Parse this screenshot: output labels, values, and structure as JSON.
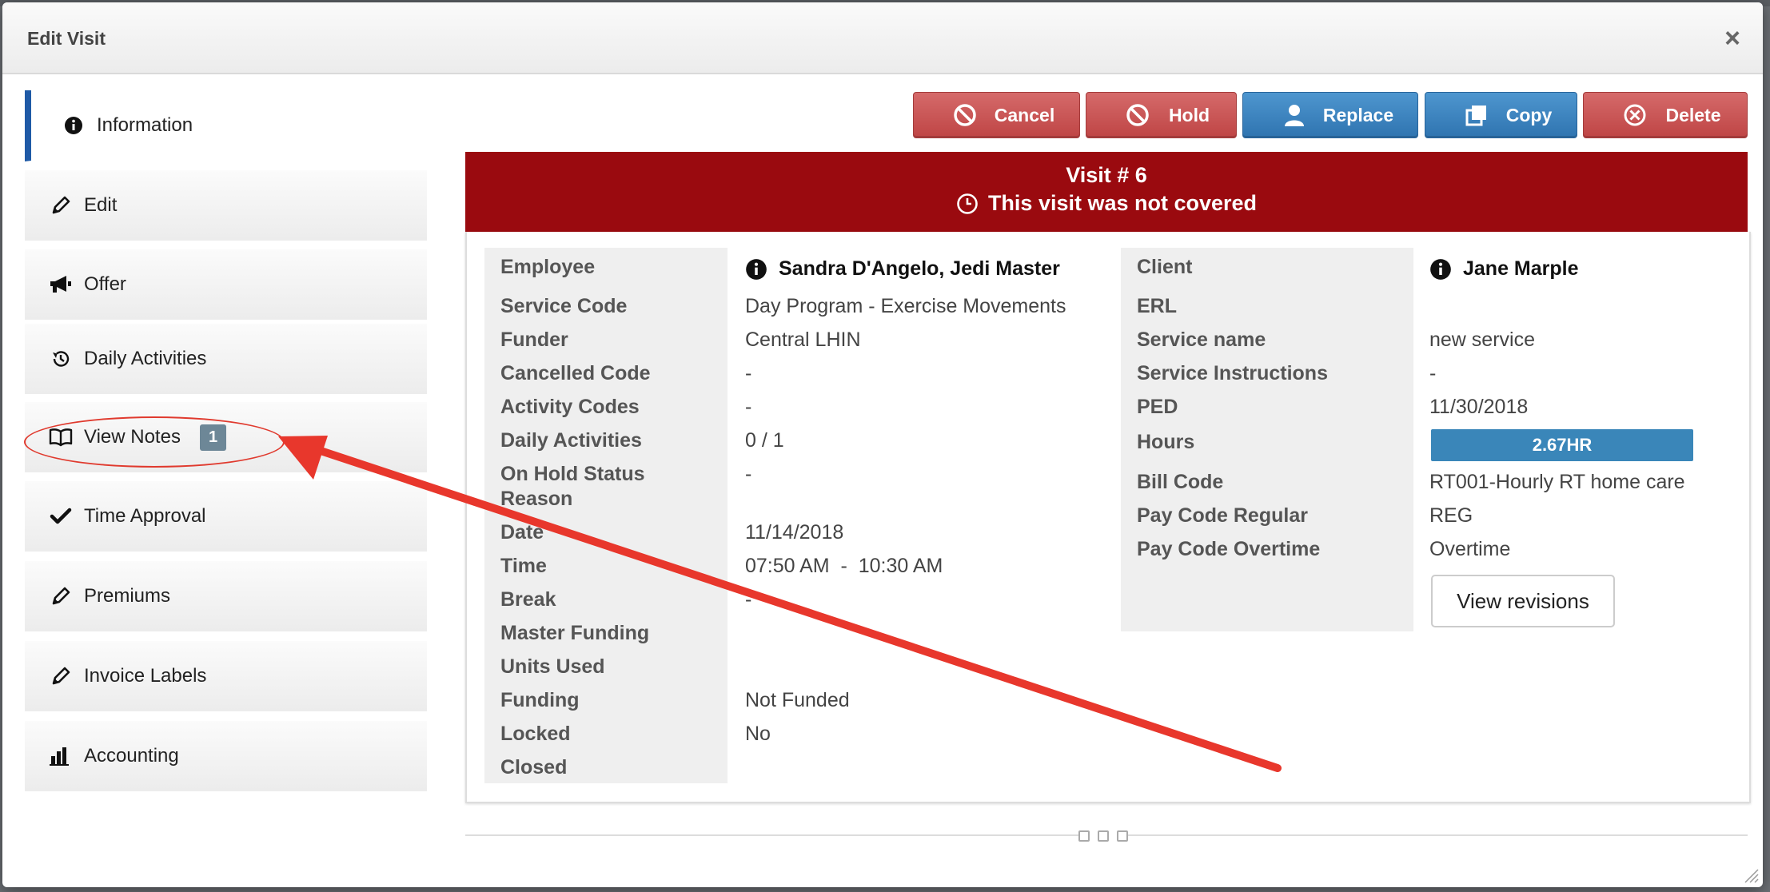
{
  "modal": {
    "title": "Edit Visit",
    "close_glyph": "×"
  },
  "sidebar": {
    "items": [
      {
        "label": "Information",
        "icon": "info-icon",
        "active": true
      },
      {
        "label": "Edit",
        "icon": "pencil-icon"
      },
      {
        "label": "Offer",
        "icon": "megaphone-icon"
      },
      {
        "label": "Daily Activities",
        "icon": "history-icon"
      },
      {
        "label": "View Notes",
        "icon": "book-icon",
        "badge": "1"
      },
      {
        "label": "Time Approval",
        "icon": "check-icon"
      },
      {
        "label": "Premiums",
        "icon": "pencil-icon"
      },
      {
        "label": "Invoice Labels",
        "icon": "pencil-icon"
      },
      {
        "label": "Accounting",
        "icon": "bar-chart-icon"
      }
    ]
  },
  "actions": {
    "cancel": "Cancel",
    "hold": "Hold",
    "replace": "Replace",
    "copy": "Copy",
    "delete": "Delete"
  },
  "banner": {
    "visit_number": "Visit # 6",
    "status": "This visit was not covered",
    "color": "#9a0a0f"
  },
  "visit": {
    "labels": {
      "employee": "Employee",
      "service_code": "Service Code",
      "funder": "Funder",
      "cancelled_code": "Cancelled Code",
      "activity_codes": "Activity Codes",
      "daily_activities": "Daily Activities",
      "on_hold_1": "On Hold Status",
      "on_hold_2": "Reason",
      "date": "Date",
      "time": "Time",
      "break": "Break",
      "master_funding": "Master Funding",
      "units_used": "Units Used",
      "funding": "Funding",
      "locked": "Locked",
      "closed": "Closed"
    },
    "values": {
      "employee": "Sandra D'Angelo, Jedi Master",
      "service_code": "Day Program - Exercise Movements",
      "funder": "Central LHIN",
      "cancelled_code": "-",
      "activity_codes": "-",
      "daily_activities": "0 / 1",
      "on_hold": "-",
      "date": "11/14/2018",
      "time": "07:50 AM  -  10:30 AM",
      "break": "-",
      "funding": "Not Funded",
      "locked": "No"
    }
  },
  "client": {
    "labels": {
      "client": "Client",
      "erl": "ERL",
      "service_name": "Service name",
      "service_instructions": "Service Instructions",
      "ped": "PED",
      "hours": "Hours",
      "bill_code": "Bill Code",
      "pay_code_regular": "Pay Code Regular",
      "pay_code_overtime": "Pay Code Overtime"
    },
    "values": {
      "client": "Jane Marple",
      "service_name": "new service",
      "service_instructions": "-",
      "ped": "11/30/2018",
      "hours": "2.67HR",
      "bill_code": "RT001-Hourly RT home care",
      "pay_code_regular": "REG",
      "pay_code_overtime": "Overtime"
    },
    "view_revisions": "View revisions"
  },
  "colors": {
    "accent_blue": "#2f74b0",
    "danger_red": "#bf4545",
    "hours_bar": "#3a86b9",
    "annotation_red": "#e8372c"
  }
}
